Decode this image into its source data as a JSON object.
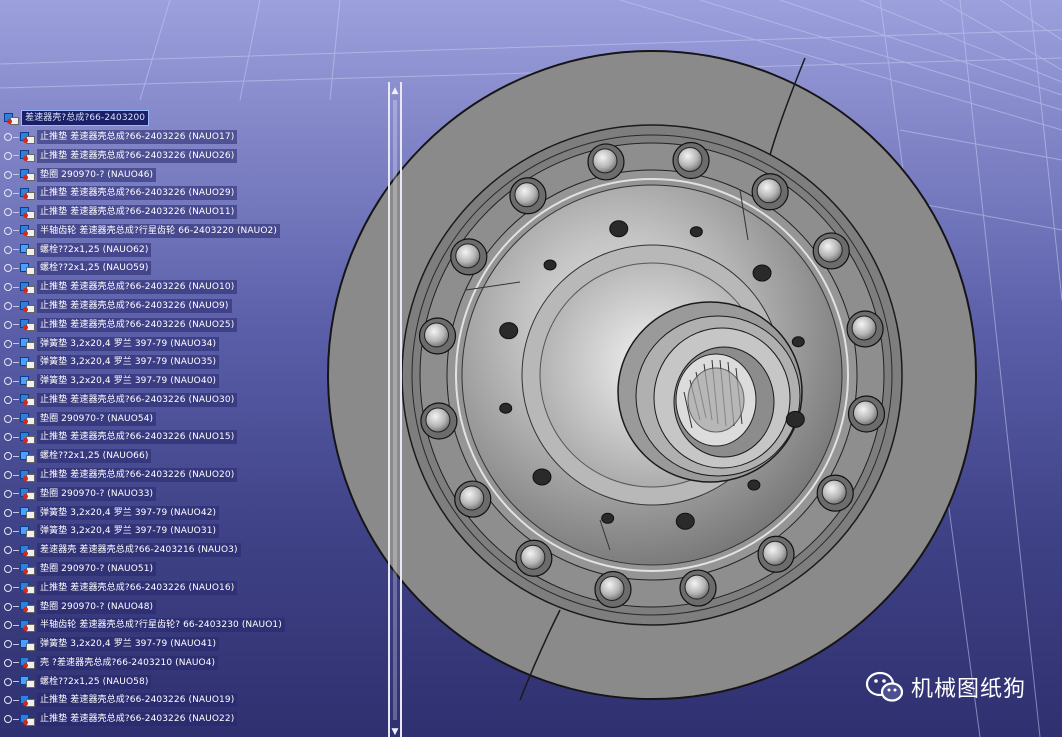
{
  "colors": {
    "viewport_top": "#9ca0dc",
    "viewport_bottom": "#2f3070",
    "part_gray": "#8c8c8c",
    "tree_label_text": "#ffffff",
    "root_highlight": "#1b1f66"
  },
  "tree": {
    "root": {
      "label": "差速器壳?总成?66-2403200",
      "icon": "product-icon"
    },
    "items": [
      {
        "label": "止推垫 差速器壳总成?66-2403226 (NAUO17)",
        "icon": "product-icon"
      },
      {
        "label": "止推垫 差速器壳总成?66-2403226 (NAUO26)",
        "icon": "product-icon"
      },
      {
        "label": "垫圈 290970-? (NAUO46)",
        "icon": "product-icon"
      },
      {
        "label": "止推垫 差速器壳总成?66-2403226 (NAUO29)",
        "icon": "product-icon"
      },
      {
        "label": "止推垫 差速器壳总成?66-2403226 (NAUO11)",
        "icon": "product-icon"
      },
      {
        "label": "半轴齿轮 差速器壳总成?行星齿轮   66-2403220 (NAUO2)",
        "icon": "product-icon"
      },
      {
        "label": "螺栓??2x1,25 (NAUO62)",
        "icon": "part-icon"
      },
      {
        "label": "螺栓??2x1,25 (NAUO59)",
        "icon": "part-icon"
      },
      {
        "label": "止推垫 差速器壳总成?66-2403226 (NAUO10)",
        "icon": "product-icon"
      },
      {
        "label": "止推垫 差速器壳总成?66-2403226 (NAUO9)",
        "icon": "product-icon"
      },
      {
        "label": "止推垫 差速器壳总成?66-2403226 (NAUO25)",
        "icon": "product-icon"
      },
      {
        "label": "弹簧垫 3,2x20,4 罗兰 397-79 (NAUO34)",
        "icon": "part-icon"
      },
      {
        "label": "弹簧垫 3,2x20,4 罗兰 397-79 (NAUO35)",
        "icon": "part-icon"
      },
      {
        "label": "弹簧垫 3,2x20,4 罗兰 397-79 (NAUO40)",
        "icon": "part-icon"
      },
      {
        "label": "止推垫 差速器壳总成?66-2403226 (NAUO30)",
        "icon": "product-icon"
      },
      {
        "label": "垫圈 290970-? (NAUO54)",
        "icon": "product-icon"
      },
      {
        "label": "止推垫 差速器壳总成?66-2403226 (NAUO15)",
        "icon": "product-icon"
      },
      {
        "label": "螺栓??2x1,25 (NAUO66)",
        "icon": "part-icon"
      },
      {
        "label": "止推垫 差速器壳总成?66-2403226 (NAUO20)",
        "icon": "product-icon"
      },
      {
        "label": "垫圈 290970-? (NAUO33)",
        "icon": "product-icon"
      },
      {
        "label": "弹簧垫 3,2x20,4 罗兰 397-79 (NAUO42)",
        "icon": "part-icon"
      },
      {
        "label": "弹簧垫 3,2x20,4 罗兰 397-79 (NAUO31)",
        "icon": "part-icon"
      },
      {
        "label": "差速器壳 差速器壳总成?66-2403216 (NAUO3)",
        "icon": "product-icon"
      },
      {
        "label": "垫圈 290970-? (NAUO51)",
        "icon": "product-icon"
      },
      {
        "label": "止推垫 差速器壳总成?66-2403226 (NAUO16)",
        "icon": "product-icon"
      },
      {
        "label": "垫圈 290970-? (NAUO48)",
        "icon": "product-icon"
      },
      {
        "label": "半轴齿轮 差速器壳总成?行星齿轮?  66-2403230 (NAUO1)",
        "icon": "product-icon"
      },
      {
        "label": "弹簧垫 3,2x20,4 罗兰 397-79 (NAUO41)",
        "icon": "part-icon"
      },
      {
        "label": "壳    ?差速器壳总成?66-2403210 (NAUO4)",
        "icon": "product-icon"
      },
      {
        "label": "螺栓??2x1,25 (NAUO58)",
        "icon": "part-icon"
      },
      {
        "label": "止推垫 差速器壳总成?66-2403226 (NAUO19)",
        "icon": "product-icon"
      },
      {
        "label": "止推垫 差速器壳总成?66-2403226 (NAUO22)",
        "icon": "product-icon"
      }
    ]
  },
  "watermark": {
    "text": "机械图纸狗",
    "icon": "wechat-icon"
  }
}
